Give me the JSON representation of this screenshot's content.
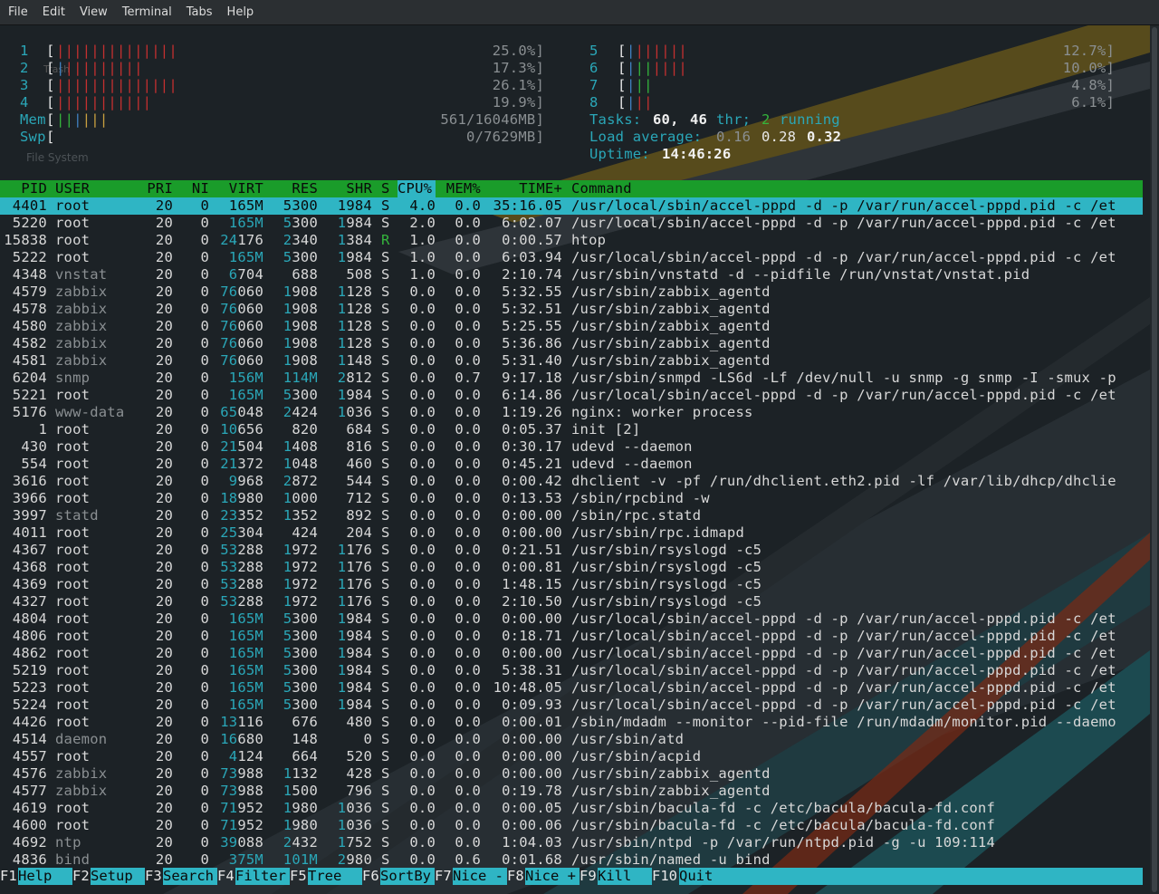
{
  "menu": [
    "File",
    "Edit",
    "View",
    "Terminal",
    "Tabs",
    "Help"
  ],
  "desktop_labels": {
    "trash": "Trash",
    "filesystem": "File System"
  },
  "cpus_left": [
    {
      "n": "1",
      "pct": "25.0%]",
      "bars": "||||||||||||||"
    },
    {
      "n": "2",
      "pct": "17.3%]",
      "bars": "||||||||||"
    },
    {
      "n": "3",
      "pct": "26.1%]",
      "bars": "||||||||||||||"
    },
    {
      "n": "4",
      "pct": "19.9%]",
      "bars": "|||||||||||"
    }
  ],
  "cpus_right": [
    {
      "n": "5",
      "pct": "12.7%]",
      "bars": "|||||||"
    },
    {
      "n": "6",
      "pct": "10.0%]",
      "bars": "|||||||"
    },
    {
      "n": "7",
      "pct": "4.8%]",
      "bars": "|||"
    },
    {
      "n": "8",
      "pct": "6.1%]",
      "bars": "|||"
    }
  ],
  "mem": {
    "label": "Mem",
    "value": "561/16046MB]",
    "bars": "||||||"
  },
  "swp": {
    "label": "Swp",
    "value": "0/7629MB]"
  },
  "tasks": {
    "label": "Tasks:",
    "count": "60,",
    "thr": "46",
    "thr_label": "thr;",
    "running": "2",
    "running_label": "running"
  },
  "load": {
    "label": "Load average:",
    "v1": "0.16",
    "v5": "0.28",
    "v15": "0.32"
  },
  "uptime": {
    "label": "Uptime:",
    "value": "14:46:26"
  },
  "columns": [
    "PID",
    "USER",
    "PRI",
    "NI",
    "VIRT",
    "RES",
    "SHR",
    "S",
    "CPU%",
    "MEM%",
    "TIME+",
    "Command"
  ],
  "processes": [
    [
      "4401",
      "root",
      "20",
      "0",
      "165M",
      "5300",
      "1984",
      "S",
      "4.0",
      "0.0",
      "35:16.05",
      "/usr/local/sbin/accel-pppd -d -p /var/run/accel-pppd.pid -c /et"
    ],
    [
      "5220",
      "root",
      "20",
      "0",
      "165M",
      "5300",
      "1984",
      "S",
      "2.0",
      "0.0",
      "6:02.07",
      "/usr/local/sbin/accel-pppd -d -p /var/run/accel-pppd.pid -c /et"
    ],
    [
      "15838",
      "root",
      "20",
      "0",
      "24176",
      "2340",
      "1384",
      "R",
      "1.0",
      "0.0",
      "0:00.57",
      "htop"
    ],
    [
      "5222",
      "root",
      "20",
      "0",
      "165M",
      "5300",
      "1984",
      "S",
      "1.0",
      "0.0",
      "6:03.94",
      "/usr/local/sbin/accel-pppd -d -p /var/run/accel-pppd.pid -c /et"
    ],
    [
      "4348",
      "vnstat",
      "20",
      "0",
      "6704",
      "688",
      "508",
      "S",
      "1.0",
      "0.0",
      "2:10.74",
      "/usr/sbin/vnstatd -d --pidfile /run/vnstat/vnstat.pid"
    ],
    [
      "4579",
      "zabbix",
      "20",
      "0",
      "76060",
      "1908",
      "1128",
      "S",
      "0.0",
      "0.0",
      "5:32.55",
      "/usr/sbin/zabbix_agentd"
    ],
    [
      "4578",
      "zabbix",
      "20",
      "0",
      "76060",
      "1908",
      "1128",
      "S",
      "0.0",
      "0.0",
      "5:32.51",
      "/usr/sbin/zabbix_agentd"
    ],
    [
      "4580",
      "zabbix",
      "20",
      "0",
      "76060",
      "1908",
      "1128",
      "S",
      "0.0",
      "0.0",
      "5:25.55",
      "/usr/sbin/zabbix_agentd"
    ],
    [
      "4582",
      "zabbix",
      "20",
      "0",
      "76060",
      "1908",
      "1128",
      "S",
      "0.0",
      "0.0",
      "5:36.86",
      "/usr/sbin/zabbix_agentd"
    ],
    [
      "4581",
      "zabbix",
      "20",
      "0",
      "76060",
      "1908",
      "1148",
      "S",
      "0.0",
      "0.0",
      "5:31.40",
      "/usr/sbin/zabbix_agentd"
    ],
    [
      "6204",
      "snmp",
      "20",
      "0",
      "156M",
      "114M",
      "2812",
      "S",
      "0.0",
      "0.7",
      "9:17.18",
      "/usr/sbin/snmpd -LS6d -Lf /dev/null -u snmp -g snmp -I -smux -p"
    ],
    [
      "5221",
      "root",
      "20",
      "0",
      "165M",
      "5300",
      "1984",
      "S",
      "0.0",
      "0.0",
      "6:14.86",
      "/usr/local/sbin/accel-pppd -d -p /var/run/accel-pppd.pid -c /et"
    ],
    [
      "5176",
      "www-data",
      "20",
      "0",
      "65048",
      "2424",
      "1036",
      "S",
      "0.0",
      "0.0",
      "1:19.26",
      "nginx: worker process"
    ],
    [
      "1",
      "root",
      "20",
      "0",
      "10656",
      "820",
      "684",
      "S",
      "0.0",
      "0.0",
      "0:05.37",
      "init [2]"
    ],
    [
      "430",
      "root",
      "20",
      "0",
      "21504",
      "1408",
      "816",
      "S",
      "0.0",
      "0.0",
      "0:30.17",
      "udevd --daemon"
    ],
    [
      "554",
      "root",
      "20",
      "0",
      "21372",
      "1048",
      "460",
      "S",
      "0.0",
      "0.0",
      "0:45.21",
      "udevd --daemon"
    ],
    [
      "3616",
      "root",
      "20",
      "0",
      "9968",
      "2872",
      "544",
      "S",
      "0.0",
      "0.0",
      "0:00.42",
      "dhclient -v -pf /run/dhclient.eth2.pid -lf /var/lib/dhcp/dhclie"
    ],
    [
      "3966",
      "root",
      "20",
      "0",
      "18980",
      "1000",
      "712",
      "S",
      "0.0",
      "0.0",
      "0:13.53",
      "/sbin/rpcbind -w"
    ],
    [
      "3997",
      "statd",
      "20",
      "0",
      "23352",
      "1352",
      "892",
      "S",
      "0.0",
      "0.0",
      "0:00.00",
      "/sbin/rpc.statd"
    ],
    [
      "4011",
      "root",
      "20",
      "0",
      "25304",
      "424",
      "204",
      "S",
      "0.0",
      "0.0",
      "0:00.00",
      "/usr/sbin/rpc.idmapd"
    ],
    [
      "4367",
      "root",
      "20",
      "0",
      "53288",
      "1972",
      "1176",
      "S",
      "0.0",
      "0.0",
      "0:21.51",
      "/usr/sbin/rsyslogd -c5"
    ],
    [
      "4368",
      "root",
      "20",
      "0",
      "53288",
      "1972",
      "1176",
      "S",
      "0.0",
      "0.0",
      "0:00.81",
      "/usr/sbin/rsyslogd -c5"
    ],
    [
      "4369",
      "root",
      "20",
      "0",
      "53288",
      "1972",
      "1176",
      "S",
      "0.0",
      "0.0",
      "1:48.15",
      "/usr/sbin/rsyslogd -c5"
    ],
    [
      "4327",
      "root",
      "20",
      "0",
      "53288",
      "1972",
      "1176",
      "S",
      "0.0",
      "0.0",
      "2:10.50",
      "/usr/sbin/rsyslogd -c5"
    ],
    [
      "4804",
      "root",
      "20",
      "0",
      "165M",
      "5300",
      "1984",
      "S",
      "0.0",
      "0.0",
      "0:00.00",
      "/usr/local/sbin/accel-pppd -d -p /var/run/accel-pppd.pid -c /et"
    ],
    [
      "4806",
      "root",
      "20",
      "0",
      "165M",
      "5300",
      "1984",
      "S",
      "0.0",
      "0.0",
      "0:18.71",
      "/usr/local/sbin/accel-pppd -d -p /var/run/accel-pppd.pid -c /et"
    ],
    [
      "4862",
      "root",
      "20",
      "0",
      "165M",
      "5300",
      "1984",
      "S",
      "0.0",
      "0.0",
      "0:00.00",
      "/usr/local/sbin/accel-pppd -d -p /var/run/accel-pppd.pid -c /et"
    ],
    [
      "5219",
      "root",
      "20",
      "0",
      "165M",
      "5300",
      "1984",
      "S",
      "0.0",
      "0.0",
      "5:38.31",
      "/usr/local/sbin/accel-pppd -d -p /var/run/accel-pppd.pid -c /et"
    ],
    [
      "5223",
      "root",
      "20",
      "0",
      "165M",
      "5300",
      "1984",
      "S",
      "0.0",
      "0.0",
      "10:48.05",
      "/usr/local/sbin/accel-pppd -d -p /var/run/accel-pppd.pid -c /et"
    ],
    [
      "5224",
      "root",
      "20",
      "0",
      "165M",
      "5300",
      "1984",
      "S",
      "0.0",
      "0.0",
      "0:09.93",
      "/usr/local/sbin/accel-pppd -d -p /var/run/accel-pppd.pid -c /et"
    ],
    [
      "4426",
      "root",
      "20",
      "0",
      "13116",
      "676",
      "480",
      "S",
      "0.0",
      "0.0",
      "0:00.01",
      "/sbin/mdadm --monitor --pid-file /run/mdadm/monitor.pid --daemo"
    ],
    [
      "4514",
      "daemon",
      "20",
      "0",
      "16680",
      "148",
      "0",
      "S",
      "0.0",
      "0.0",
      "0:00.00",
      "/usr/sbin/atd"
    ],
    [
      "4557",
      "root",
      "20",
      "0",
      "4124",
      "664",
      "520",
      "S",
      "0.0",
      "0.0",
      "0:00.00",
      "/usr/sbin/acpid"
    ],
    [
      "4576",
      "zabbix",
      "20",
      "0",
      "73988",
      "1132",
      "428",
      "S",
      "0.0",
      "0.0",
      "0:00.00",
      "/usr/sbin/zabbix_agentd"
    ],
    [
      "4577",
      "zabbix",
      "20",
      "0",
      "73988",
      "1500",
      "796",
      "S",
      "0.0",
      "0.0",
      "0:19.78",
      "/usr/sbin/zabbix_agentd"
    ],
    [
      "4619",
      "root",
      "20",
      "0",
      "71952",
      "1980",
      "1036",
      "S",
      "0.0",
      "0.0",
      "0:00.05",
      "/usr/sbin/bacula-fd -c /etc/bacula/bacula-fd.conf"
    ],
    [
      "4600",
      "root",
      "20",
      "0",
      "71952",
      "1980",
      "1036",
      "S",
      "0.0",
      "0.0",
      "0:00.06",
      "/usr/sbin/bacula-fd -c /etc/bacula/bacula-fd.conf"
    ],
    [
      "4692",
      "ntp",
      "20",
      "0",
      "39088",
      "2432",
      "1752",
      "S",
      "0.0",
      "0.0",
      "1:04.03",
      "/usr/sbin/ntpd -p /var/run/ntpd.pid -g -u 109:114"
    ],
    [
      "4836",
      "bind",
      "20",
      "0",
      "375M",
      "101M",
      "2980",
      "S",
      "0.0",
      "0.6",
      "0:01.68",
      "/usr/sbin/named -u bind"
    ]
  ],
  "fkeys": [
    {
      "key": "F1",
      "label": "Help"
    },
    {
      "key": "F2",
      "label": "Setup"
    },
    {
      "key": "F3",
      "label": "Search"
    },
    {
      "key": "F4",
      "label": "Filter"
    },
    {
      "key": "F5",
      "label": "Tree"
    },
    {
      "key": "F6",
      "label": "SortBy"
    },
    {
      "key": "F7",
      "label": "Nice -"
    },
    {
      "key": "F8",
      "label": "Nice +"
    },
    {
      "key": "F9",
      "label": "Kill"
    },
    {
      "key": "F10",
      "label": "Quit"
    }
  ],
  "colors": {
    "header_bg": "#1a9c2a",
    "selected_bg": "#2fb5c4",
    "cyan": "#2aa7b8",
    "green": "#34b43c",
    "red": "#c43030"
  }
}
